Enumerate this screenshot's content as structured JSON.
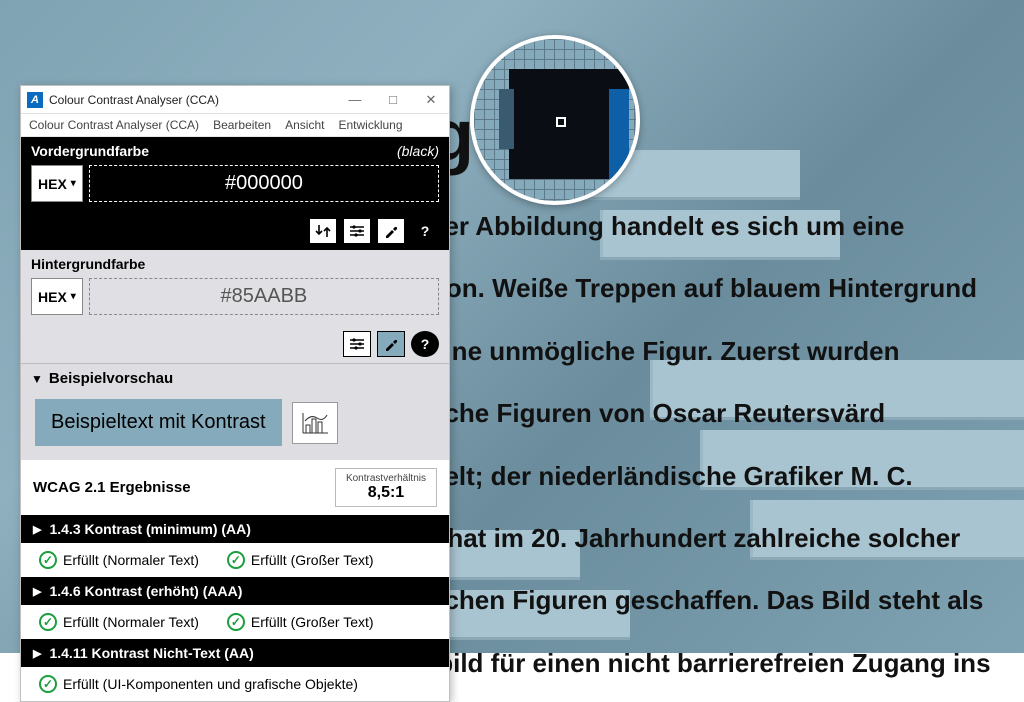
{
  "bg": {
    "title_fragment": "ga",
    "lines": [
      "ser Abbildung handelt es sich um eine",
      "tion. Weiße Treppen auf blauem Hintergrund",
      "eine unmögliche Figur. Zuerst wurden",
      "liche Figuren von Oscar Reutersvärd",
      "kelt; der niederländische Grafiker M. C.",
      "r hat im 20. Jahrhundert zahlreiche solcher",
      "lichen Figuren geschaffen. Das Bild steht als",
      "lbild für einen nicht barrierefreien Zugang ins"
    ]
  },
  "window": {
    "title": "Colour Contrast Analyser (CCA)",
    "menu": [
      "Colour Contrast Analyser (CCA)",
      "Bearbeiten",
      "Ansicht",
      "Entwicklung"
    ]
  },
  "foreground": {
    "label": "Vordergrundfarbe",
    "color_name": "(black)",
    "format": "HEX",
    "value": "#000000"
  },
  "background_color": {
    "label": "Hintergrundfarbe",
    "format": "HEX",
    "value": "#85AABB"
  },
  "preview": {
    "header": "Beispielvorschau",
    "text": "Beispieltext mit Kontrast"
  },
  "results": {
    "title": "WCAG 2.1 Ergebnisse",
    "ratio_label": "Kontrastverhältnis",
    "ratio_value": "8,5:1",
    "criteria": [
      {
        "title": "1.4.3 Kontrast (minimum) (AA)",
        "items": [
          "Erfüllt (Normaler Text)",
          "Erfüllt (Großer Text)"
        ]
      },
      {
        "title": "1.4.6 Kontrast (erhöht) (AAA)",
        "items": [
          "Erfüllt (Normaler Text)",
          "Erfüllt (Großer Text)"
        ]
      },
      {
        "title": "1.4.11 Kontrast Nicht-Text (AA)",
        "items": [
          "Erfüllt (UI-Komponenten und grafische Objekte)"
        ]
      }
    ]
  }
}
